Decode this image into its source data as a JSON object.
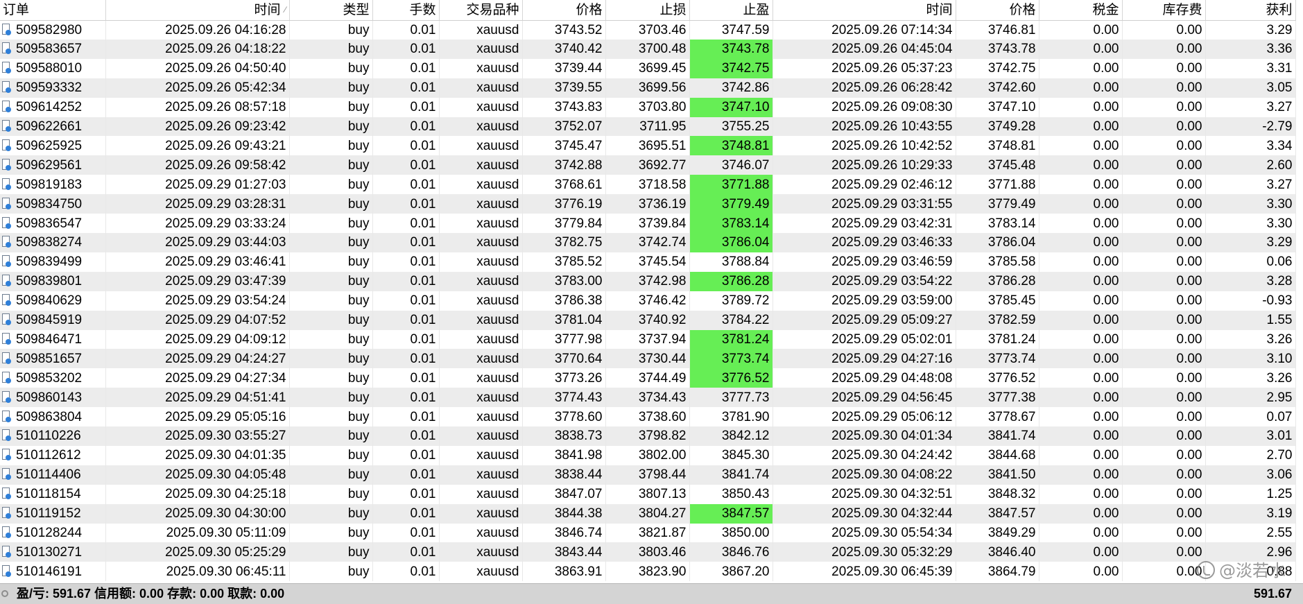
{
  "columns": [
    {
      "key": "order",
      "label": "订单"
    },
    {
      "key": "open_time",
      "label": "时间"
    },
    {
      "key": "type",
      "label": "类型"
    },
    {
      "key": "volume",
      "label": "手数"
    },
    {
      "key": "symbol",
      "label": "交易品种"
    },
    {
      "key": "open_price",
      "label": "价格"
    },
    {
      "key": "sl",
      "label": "止损"
    },
    {
      "key": "tp",
      "label": "止盈"
    },
    {
      "key": "close_time",
      "label": "时间"
    },
    {
      "key": "close_price",
      "label": "价格"
    },
    {
      "key": "tax",
      "label": "税金"
    },
    {
      "key": "swap",
      "label": "库存费"
    },
    {
      "key": "profit",
      "label": "获利"
    }
  ],
  "rows": [
    [
      "509582980",
      "2025.09.26 04:16:28",
      "buy",
      "0.01",
      "xauusd",
      "3743.52",
      "3703.46",
      "3747.59",
      "2025.09.26 07:14:34",
      "3746.81",
      "0.00",
      "0.00",
      "3.29"
    ],
    [
      "509583657",
      "2025.09.26 04:18:22",
      "buy",
      "0.01",
      "xauusd",
      "3740.42",
      "3700.48",
      "3743.78",
      "2025.09.26 04:45:04",
      "3743.78",
      "0.00",
      "0.00",
      "3.36"
    ],
    [
      "509588010",
      "2025.09.26 04:50:40",
      "buy",
      "0.01",
      "xauusd",
      "3739.44",
      "3699.45",
      "3742.75",
      "2025.09.26 05:37:23",
      "3742.75",
      "0.00",
      "0.00",
      "3.31"
    ],
    [
      "509593332",
      "2025.09.26 05:42:34",
      "buy",
      "0.01",
      "xauusd",
      "3739.55",
      "3699.56",
      "3742.86",
      "2025.09.26 06:28:42",
      "3742.60",
      "0.00",
      "0.00",
      "3.05"
    ],
    [
      "509614252",
      "2025.09.26 08:57:18",
      "buy",
      "0.01",
      "xauusd",
      "3743.83",
      "3703.80",
      "3747.10",
      "2025.09.26 09:08:30",
      "3747.10",
      "0.00",
      "0.00",
      "3.27"
    ],
    [
      "509622661",
      "2025.09.26 09:23:42",
      "buy",
      "0.01",
      "xauusd",
      "3752.07",
      "3711.95",
      "3755.25",
      "2025.09.26 10:43:55",
      "3749.28",
      "0.00",
      "0.00",
      "-2.79"
    ],
    [
      "509625925",
      "2025.09.26 09:43:21",
      "buy",
      "0.01",
      "xauusd",
      "3745.47",
      "3695.51",
      "3748.81",
      "2025.09.26 10:42:52",
      "3748.81",
      "0.00",
      "0.00",
      "3.34"
    ],
    [
      "509629561",
      "2025.09.26 09:58:42",
      "buy",
      "0.01",
      "xauusd",
      "3742.88",
      "3692.77",
      "3746.07",
      "2025.09.26 10:29:33",
      "3745.48",
      "0.00",
      "0.00",
      "2.60"
    ],
    [
      "509819183",
      "2025.09.29 01:27:03",
      "buy",
      "0.01",
      "xauusd",
      "3768.61",
      "3718.58",
      "3771.88",
      "2025.09.29 02:46:12",
      "3771.88",
      "0.00",
      "0.00",
      "3.27"
    ],
    [
      "509834750",
      "2025.09.29 03:28:31",
      "buy",
      "0.01",
      "xauusd",
      "3776.19",
      "3736.19",
      "3779.49",
      "2025.09.29 03:31:55",
      "3779.49",
      "0.00",
      "0.00",
      "3.30"
    ],
    [
      "509836547",
      "2025.09.29 03:33:24",
      "buy",
      "0.01",
      "xauusd",
      "3779.84",
      "3739.84",
      "3783.14",
      "2025.09.29 03:42:31",
      "3783.14",
      "0.00",
      "0.00",
      "3.30"
    ],
    [
      "509838274",
      "2025.09.29 03:44:03",
      "buy",
      "0.01",
      "xauusd",
      "3782.75",
      "3742.74",
      "3786.04",
      "2025.09.29 03:46:33",
      "3786.04",
      "0.00",
      "0.00",
      "3.29"
    ],
    [
      "509839499",
      "2025.09.29 03:46:41",
      "buy",
      "0.01",
      "xauusd",
      "3785.52",
      "3745.54",
      "3788.84",
      "2025.09.29 03:46:59",
      "3785.58",
      "0.00",
      "0.00",
      "0.06"
    ],
    [
      "509839801",
      "2025.09.29 03:47:39",
      "buy",
      "0.01",
      "xauusd",
      "3783.00",
      "3742.98",
      "3786.28",
      "2025.09.29 03:54:22",
      "3786.28",
      "0.00",
      "0.00",
      "3.28"
    ],
    [
      "509840629",
      "2025.09.29 03:54:24",
      "buy",
      "0.01",
      "xauusd",
      "3786.38",
      "3746.42",
      "3789.72",
      "2025.09.29 03:59:00",
      "3785.45",
      "0.00",
      "0.00",
      "-0.93"
    ],
    [
      "509845919",
      "2025.09.29 04:07:52",
      "buy",
      "0.01",
      "xauusd",
      "3781.04",
      "3740.92",
      "3784.22",
      "2025.09.29 05:09:27",
      "3782.59",
      "0.00",
      "0.00",
      "1.55"
    ],
    [
      "509846471",
      "2025.09.29 04:09:12",
      "buy",
      "0.01",
      "xauusd",
      "3777.98",
      "3737.94",
      "3781.24",
      "2025.09.29 05:02:01",
      "3781.24",
      "0.00",
      "0.00",
      "3.26"
    ],
    [
      "509851657",
      "2025.09.29 04:24:27",
      "buy",
      "0.01",
      "xauusd",
      "3770.64",
      "3730.44",
      "3773.74",
      "2025.09.29 04:27:16",
      "3773.74",
      "0.00",
      "0.00",
      "3.10"
    ],
    [
      "509853202",
      "2025.09.29 04:27:34",
      "buy",
      "0.01",
      "xauusd",
      "3773.26",
      "3744.49",
      "3776.52",
      "2025.09.29 04:48:08",
      "3776.52",
      "0.00",
      "0.00",
      "3.26"
    ],
    [
      "509860143",
      "2025.09.29 04:51:41",
      "buy",
      "0.01",
      "xauusd",
      "3774.43",
      "3734.43",
      "3777.73",
      "2025.09.29 04:56:45",
      "3777.38",
      "0.00",
      "0.00",
      "2.95"
    ],
    [
      "509863804",
      "2025.09.29 05:05:16",
      "buy",
      "0.01",
      "xauusd",
      "3778.60",
      "3738.60",
      "3781.90",
      "2025.09.29 05:06:12",
      "3778.67",
      "0.00",
      "0.00",
      "0.07"
    ],
    [
      "510110226",
      "2025.09.30 03:55:27",
      "buy",
      "0.01",
      "xauusd",
      "3838.73",
      "3798.82",
      "3842.12",
      "2025.09.30 04:01:34",
      "3841.74",
      "0.00",
      "0.00",
      "3.01"
    ],
    [
      "510112612",
      "2025.09.30 04:01:35",
      "buy",
      "0.01",
      "xauusd",
      "3841.98",
      "3802.00",
      "3845.30",
      "2025.09.30 04:24:42",
      "3844.68",
      "0.00",
      "0.00",
      "2.70"
    ],
    [
      "510114406",
      "2025.09.30 04:05:48",
      "buy",
      "0.01",
      "xauusd",
      "3838.44",
      "3798.44",
      "3841.74",
      "2025.09.30 04:08:22",
      "3841.50",
      "0.00",
      "0.00",
      "3.06"
    ],
    [
      "510118154",
      "2025.09.30 04:25:18",
      "buy",
      "0.01",
      "xauusd",
      "3847.07",
      "3807.13",
      "3850.43",
      "2025.09.30 04:32:51",
      "3848.32",
      "0.00",
      "0.00",
      "1.25"
    ],
    [
      "510119152",
      "2025.09.30 04:30:00",
      "buy",
      "0.01",
      "xauusd",
      "3844.38",
      "3804.27",
      "3847.57",
      "2025.09.30 04:32:44",
      "3847.57",
      "0.00",
      "0.00",
      "3.19"
    ],
    [
      "510128244",
      "2025.09.30 05:11:09",
      "buy",
      "0.01",
      "xauusd",
      "3846.74",
      "3821.87",
      "3850.00",
      "2025.09.30 05:54:34",
      "3849.29",
      "0.00",
      "0.00",
      "2.55"
    ],
    [
      "510130271",
      "2025.09.30 05:25:29",
      "buy",
      "0.01",
      "xauusd",
      "3843.44",
      "3803.46",
      "3846.76",
      "2025.09.30 05:32:29",
      "3846.40",
      "0.00",
      "0.00",
      "2.96"
    ],
    [
      "510146191",
      "2025.09.30 06:45:11",
      "buy",
      "0.01",
      "xauusd",
      "3863.91",
      "3823.90",
      "3867.20",
      "2025.09.30 06:45:39",
      "3864.79",
      "0.00",
      "0.00",
      "0.88"
    ]
  ],
  "tp_hit_rows": [
    1,
    2,
    4,
    6,
    8,
    9,
    10,
    11,
    13,
    16,
    17,
    18,
    25
  ],
  "status": {
    "summary": "盈/亏: 591.67  信用额: 0.00  存款: 0.00  取款: 0.00",
    "total": "591.67"
  },
  "watermark": "@淡若水",
  "colors": {
    "tp_hit": "#66ee55",
    "stripe": "#ececec"
  },
  "icons": {
    "order_row": "document-icon"
  }
}
